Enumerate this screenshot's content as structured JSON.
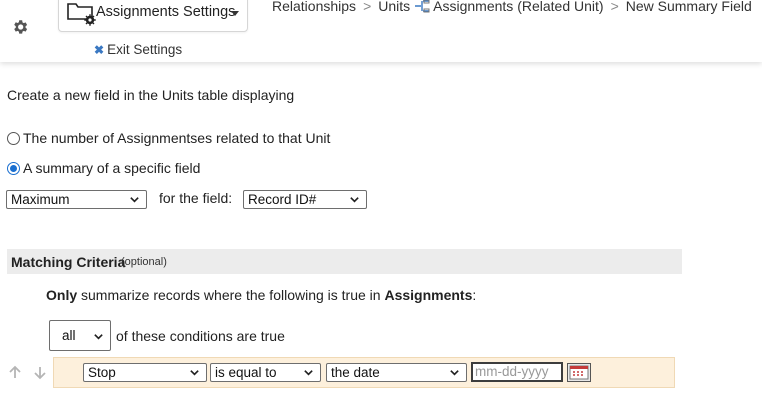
{
  "header": {
    "settings_label": "Assignments Settings",
    "exit_label": "Exit Settings",
    "breadcrumb": [
      "Relationships",
      "Units",
      "Assignments (Related Unit)",
      "New Summary Field"
    ]
  },
  "form": {
    "intro": "Create a new field in the Units table displaying",
    "option_count": "The number of Assignmentses related to that Unit",
    "option_summary": "A summary of a specific field",
    "selected_option": "summary",
    "aggregate_value": "Maximum",
    "for_field_label": "for the field:",
    "field_value": "Record ID#"
  },
  "matching": {
    "title": "Matching Criteria",
    "optional": "(optional)",
    "only_prefix": "Only",
    "only_middle": " summarize records where the following is true in ",
    "only_table": "Assignments",
    "only_suffix": ":",
    "all_value": "all",
    "conditions_text": "of these conditions are true",
    "condition": {
      "field": "Stop",
      "operator": "is equal to",
      "value_type": "the date",
      "date_placeholder": "mm-dd-yyyy"
    }
  },
  "colors": {
    "accent": "#1a6fd0",
    "condition_bg": "#fdf0dc",
    "header_bg": "#ececec"
  },
  "icons": [
    "gear-icon",
    "folder-settings-icon",
    "chevron-down-icon",
    "close-icon",
    "relationship-icon",
    "arrow-up-icon",
    "arrow-down-icon",
    "calendar-icon"
  ]
}
